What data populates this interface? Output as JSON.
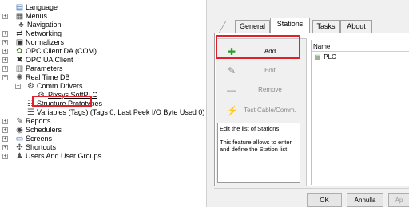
{
  "tree": {
    "items": [
      {
        "label": "Language",
        "icon": "language-icon",
        "glyph": "▤",
        "expander": ""
      },
      {
        "label": "Menus",
        "icon": "menus-icon",
        "glyph": "▦",
        "expander": "+"
      },
      {
        "label": "Navigation",
        "icon": "navigation-icon",
        "glyph": "♣",
        "expander": ""
      },
      {
        "label": "Networking",
        "icon": "networking-icon",
        "glyph": "⇄",
        "expander": "+"
      },
      {
        "label": "Normalizers",
        "icon": "normalizers-icon",
        "glyph": "▣",
        "expander": "+"
      },
      {
        "label": "OPC Client DA (COM)",
        "icon": "opc-da-icon",
        "glyph": "✿",
        "expander": "+"
      },
      {
        "label": "OPC UA Client",
        "icon": "opc-ua-icon",
        "glyph": "✖",
        "expander": "+"
      },
      {
        "label": "Parameters",
        "icon": "parameters-icon",
        "glyph": "▥",
        "expander": "+"
      },
      {
        "label": "Real Time DB",
        "icon": "database-icon",
        "glyph": "✺",
        "expander": "−"
      },
      {
        "label": "Comm.Drivers",
        "icon": "comm-drivers-icon",
        "glyph": "⚙",
        "expander": "−"
      },
      {
        "label": "Pixsys SoftPLC",
        "icon": "driver-icon",
        "glyph": "⚙",
        "expander": ""
      },
      {
        "label": "Structure Prototypes",
        "icon": "structure-icon",
        "glyph": "☷",
        "expander": ""
      },
      {
        "label": "Variables (Tags) (Tags 0, Last Peek I/O Byte Used 0)",
        "icon": "variables-icon",
        "glyph": "☰",
        "expander": ""
      },
      {
        "label": "Reports",
        "icon": "reports-icon",
        "glyph": "✎",
        "expander": "+"
      },
      {
        "label": "Schedulers",
        "icon": "schedulers-icon",
        "glyph": "◉",
        "expander": "+"
      },
      {
        "label": "Screens",
        "icon": "screens-icon",
        "glyph": "▭",
        "expander": "+"
      },
      {
        "label": "Shortcuts",
        "icon": "shortcuts-icon",
        "glyph": "✣",
        "expander": "+"
      },
      {
        "label": "Users And User Groups",
        "icon": "users-icon",
        "glyph": "♟",
        "expander": "+"
      }
    ]
  },
  "dialog": {
    "tabs": [
      "General",
      "Stations",
      "Tasks",
      "About"
    ],
    "active_tab": "Stations",
    "side_buttons": [
      {
        "label": "Add",
        "icon": "add-icon",
        "glyph": "✚",
        "enabled": true
      },
      {
        "label": "Edit",
        "icon": "edit-icon",
        "glyph": "✎",
        "enabled": false
      },
      {
        "label": "Remove",
        "icon": "remove-icon",
        "glyph": "—",
        "enabled": false
      },
      {
        "label": "Test Cable/Comm.",
        "icon": "test-cable-icon",
        "glyph": "⚡",
        "enabled": false
      }
    ],
    "description": [
      "Edit the list of Stations.",
      "This feature allows to enter and define the Station list"
    ],
    "list": {
      "columns": [
        "Name",
        ""
      ],
      "rows": [
        {
          "name": "PLC",
          "icon": "plc-station-icon",
          "glyph": "▤"
        }
      ]
    },
    "buttons": {
      "ok": "OK",
      "cancel": "Annulla",
      "apply": "Ap"
    }
  },
  "colors": {
    "highlight": "#e0202a",
    "panel": "#f0f0f0"
  }
}
